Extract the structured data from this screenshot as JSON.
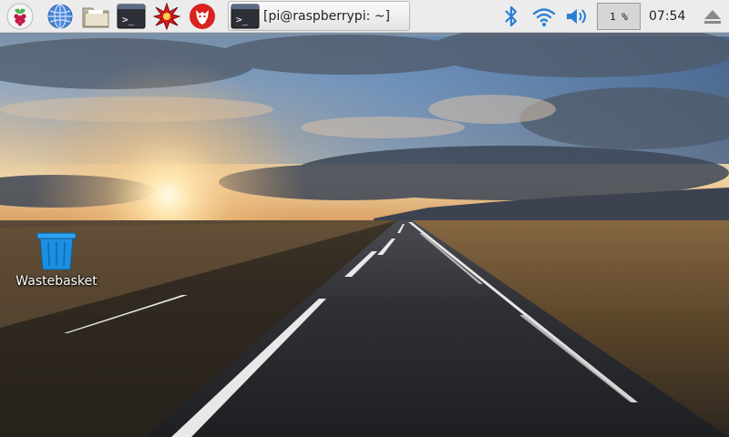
{
  "taskbar": {
    "launchers": [
      {
        "name": "raspberry-menu",
        "icon": "raspberry-icon"
      },
      {
        "name": "web-browser",
        "icon": "globe-icon"
      },
      {
        "name": "file-manager",
        "icon": "folder-icon"
      },
      {
        "name": "terminal",
        "icon": "terminal-icon"
      },
      {
        "name": "mathematica",
        "icon": "red-star-icon"
      },
      {
        "name": "wolfram",
        "icon": "wolf-icon"
      }
    ],
    "task": {
      "label": "[pi@raspberrypi: ~]",
      "icon": "terminal-icon"
    },
    "tray": {
      "bluetooth": "bluetooth-icon",
      "wifi": "wifi-icon",
      "volume": "speaker-icon",
      "cpu": "1 %",
      "clock": "07:54",
      "eject": "eject-icon"
    }
  },
  "desktop": {
    "icons": [
      {
        "label": "Wastebasket",
        "icon": "trash-bin-icon"
      }
    ]
  },
  "colors": {
    "taskbar": "#ececec",
    "tray_icon": "#2a7fd4",
    "bin": "#1d8fe0"
  }
}
